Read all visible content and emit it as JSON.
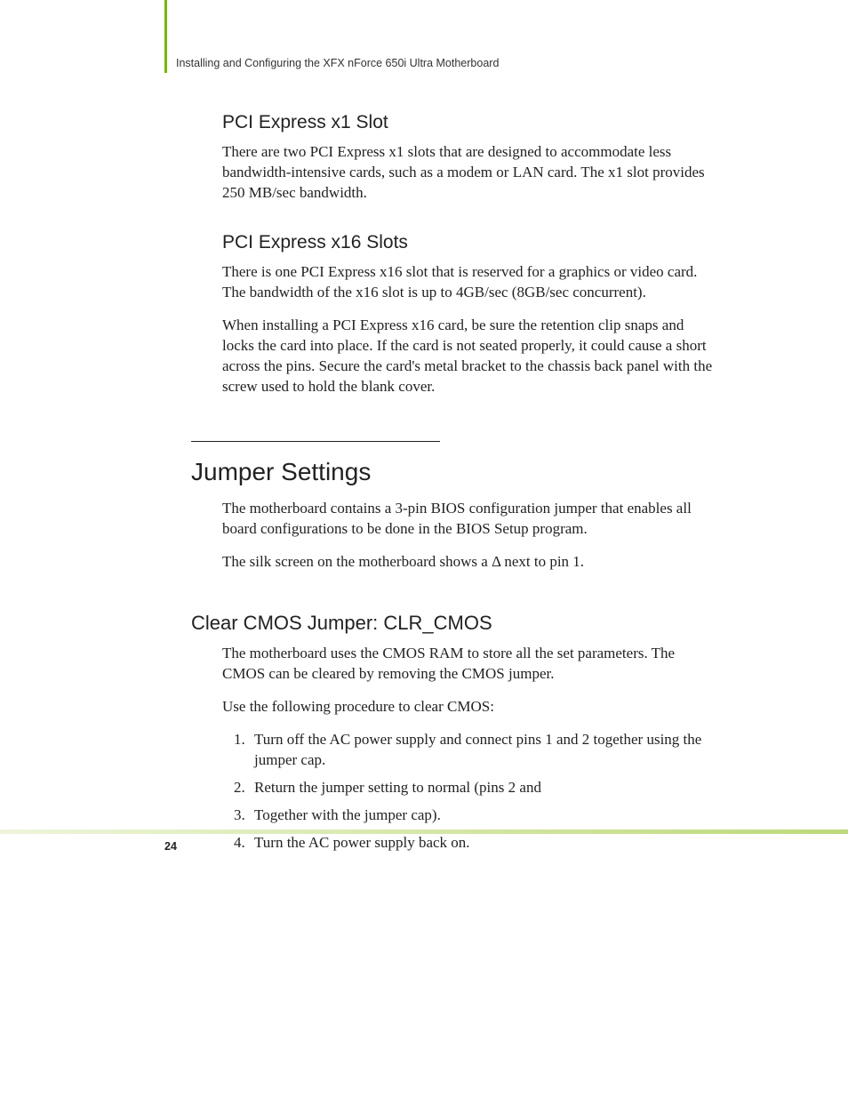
{
  "header": {
    "running_title": "Installing and Configuring the XFX nForce 650i Ultra Motherboard"
  },
  "sections": {
    "pci_x1": {
      "heading": "PCI Express x1 Slot",
      "p1": "There are two PCI Express x1 slots that are designed to accommodate less bandwidth-intensive cards, such as a modem or LAN card. The x1 slot provides 250 MB/sec bandwidth."
    },
    "pci_x16": {
      "heading": "PCI Express x16 Slots",
      "p1": "There is one PCI Express x16 slot that is reserved for a graphics or video card. The bandwidth of the x16 slot is up to 4GB/sec (8GB/sec concurrent).",
      "p2": "When installing a PCI Express x16 card, be sure the retention clip snaps and locks the card into place. If the card is not seated properly, it could cause a short across the pins. Secure the card's metal bracket to the chassis back panel with the screw used to hold the blank cover."
    },
    "jumper": {
      "heading": "Jumper Settings",
      "p1": "The motherboard contains a 3-pin BIOS configuration jumper that enables all board configurations to be done in the BIOS Setup program.",
      "p2": "The silk screen on the motherboard shows a Δ next to pin 1."
    },
    "clear_cmos": {
      "heading": "Clear CMOS Jumper: CLR_CMOS",
      "p1": "The motherboard uses the CMOS RAM to store all the set parameters. The CMOS can be cleared by removing the CMOS jumper.",
      "p2": "Use the following procedure to clear CMOS:",
      "steps": [
        "Turn off the AC power supply and connect pins 1 and 2 together using the jumper cap.",
        "Return the jumper setting to normal (pins 2 and",
        "Together with the jumper cap).",
        "Turn the AC power supply back on."
      ]
    }
  },
  "footer": {
    "page_number": "24"
  }
}
